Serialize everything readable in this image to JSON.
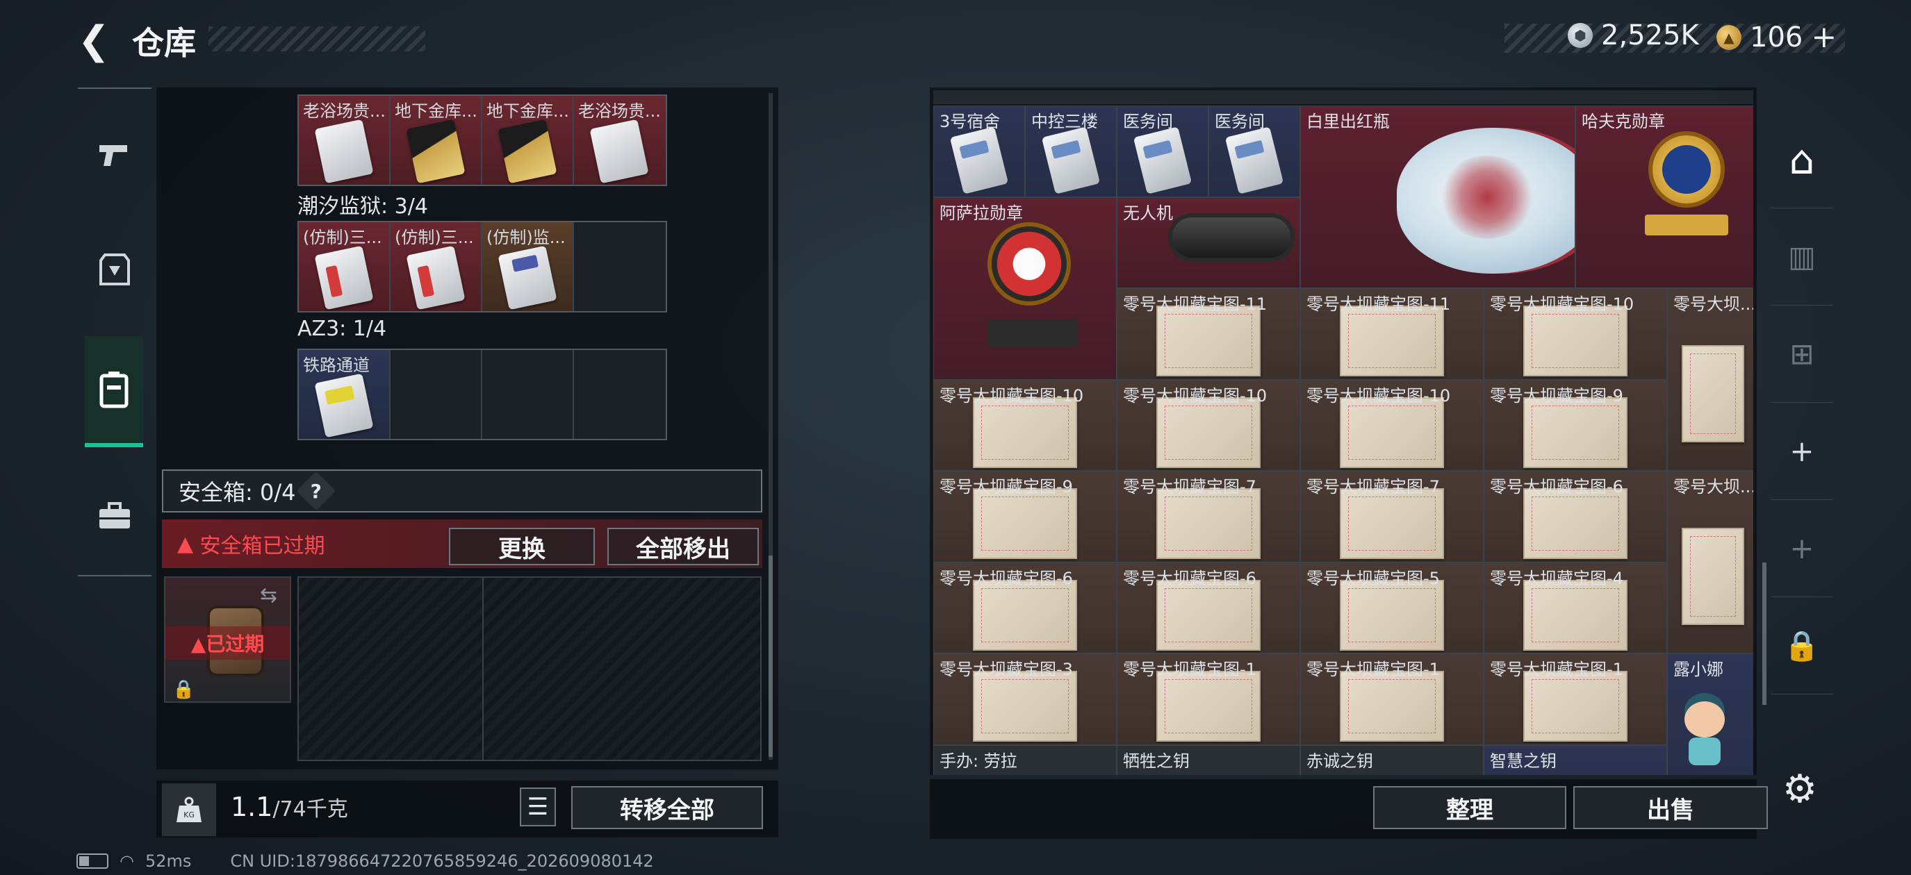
{
  "header": {
    "title": "仓库",
    "silver_amount": "2,525K",
    "gold_amount": "106",
    "gold_plus": "+"
  },
  "sidenav": {
    "items": [
      {
        "icon": "gun-icon",
        "glyph": "▰"
      },
      {
        "icon": "armor-icon",
        "glyph": "⬙"
      },
      {
        "icon": "backpack-icon",
        "glyph": "▣",
        "active": true
      },
      {
        "icon": "toolbox-icon",
        "glyph": "▬"
      }
    ]
  },
  "left": {
    "group1_items": [
      {
        "name": "老浴场贵...",
        "color": "red",
        "card": "white"
      },
      {
        "name": "地下金库...",
        "color": "red",
        "card": "gold"
      },
      {
        "name": "地下金库...",
        "color": "red",
        "card": "gold"
      },
      {
        "name": "老浴场贵...",
        "color": "red",
        "card": "white"
      }
    ],
    "group2_label": "潮汐监狱: 3/4",
    "group2_items": [
      {
        "name": "(仿制)三...",
        "color": "red",
        "card": "red"
      },
      {
        "name": "(仿制)三...",
        "color": "red",
        "card": "red"
      },
      {
        "name": "(仿制)监...",
        "color": "gold",
        "card": "blue"
      },
      {
        "name": "",
        "color": "empty"
      }
    ],
    "group3_label": "AZ3: 1/4",
    "group3_items": [
      {
        "name": "铁路通道",
        "color": "blue",
        "card": "yellow"
      },
      {
        "name": "",
        "color": "empty"
      },
      {
        "name": "",
        "color": "empty"
      },
      {
        "name": "",
        "color": "empty"
      }
    ],
    "safebox_label": "安全箱: 0/4",
    "safebox_help": "?",
    "expired_warning": "安全箱已过期",
    "replace_button": "更换",
    "remove_all_button": "全部移出",
    "case_status": "已过期",
    "weight_value": "1.1",
    "weight_capacity": "/74千克",
    "kg_label": "KG",
    "transfer_all_button": "转移全部"
  },
  "right": {
    "cells": [
      {
        "name": "3号宿舍",
        "color": "blue",
        "kind": "card",
        "col": 0,
        "row": 0
      },
      {
        "name": "中控三楼",
        "color": "blue",
        "kind": "card",
        "col": 1,
        "row": 0
      },
      {
        "name": "医务间",
        "color": "blue",
        "kind": "card",
        "col": 2,
        "row": 0
      },
      {
        "name": "医务间",
        "color": "blue",
        "kind": "card",
        "col": 3,
        "row": 0
      },
      {
        "name": "白里出红瓶",
        "color": "red",
        "kind": "vase",
        "col": 4,
        "row": 0,
        "w": 3,
        "h": 2
      },
      {
        "name": "哈夫克勋章",
        "color": "red",
        "kind": "medal",
        "col": 7,
        "row": 0,
        "w": 2,
        "h": 2
      },
      {
        "name": "阿萨拉勋章",
        "color": "red",
        "kind": "redmedal",
        "col": 0,
        "row": 1,
        "w": 2,
        "h": 2
      },
      {
        "name": "无人机",
        "color": "red",
        "kind": "drone",
        "col": 2,
        "row": 1,
        "w": 2,
        "h": 1
      },
      {
        "name": "零号大坝藏宝图-11",
        "color": "brown",
        "kind": "map",
        "col": 2,
        "row": 2,
        "w": 2
      },
      {
        "name": "零号大坝藏宝图-11",
        "color": "brown",
        "kind": "map",
        "col": 4,
        "row": 2,
        "w": 2
      },
      {
        "name": "零号大坝藏宝图-10",
        "color": "brown",
        "kind": "map",
        "col": 6,
        "row": 2,
        "w": 2
      },
      {
        "name": "零号大坝...",
        "color": "brown",
        "kind": "maptall",
        "col": 8,
        "row": 2,
        "w": 1,
        "h": 2
      },
      {
        "name": "零号大坝藏宝图-10",
        "color": "brown",
        "kind": "map",
        "col": 0,
        "row": 3,
        "w": 2
      },
      {
        "name": "零号大坝藏宝图-10",
        "color": "brown",
        "kind": "map",
        "col": 2,
        "row": 3,
        "w": 2
      },
      {
        "name": "零号大坝藏宝图-10",
        "color": "brown",
        "kind": "map",
        "col": 4,
        "row": 3,
        "w": 2
      },
      {
        "name": "零号大坝藏宝图-9",
        "color": "brown",
        "kind": "map",
        "col": 6,
        "row": 3,
        "w": 2
      },
      {
        "name": "零号大坝藏宝图-9",
        "color": "brown",
        "kind": "map",
        "col": 0,
        "row": 4,
        "w": 2
      },
      {
        "name": "零号大坝藏宝图-7",
        "color": "brown",
        "kind": "map",
        "col": 2,
        "row": 4,
        "w": 2
      },
      {
        "name": "零号大坝藏宝图-7",
        "color": "brown",
        "kind": "map",
        "col": 4,
        "row": 4,
        "w": 2
      },
      {
        "name": "零号大坝藏宝图-6",
        "color": "brown",
        "kind": "map",
        "col": 6,
        "row": 4,
        "w": 2
      },
      {
        "name": "零号大坝...",
        "color": "brown",
        "kind": "maptall",
        "col": 8,
        "row": 4,
        "w": 1,
        "h": 2
      },
      {
        "name": "零号大坝藏宝图-6",
        "color": "brown",
        "kind": "map",
        "col": 0,
        "row": 5,
        "w": 2
      },
      {
        "name": "零号大坝藏宝图-6",
        "color": "brown",
        "kind": "map",
        "col": 2,
        "row": 5,
        "w": 2
      },
      {
        "name": "零号大坝藏宝图-5",
        "color": "brown",
        "kind": "map",
        "col": 4,
        "row": 5,
        "w": 2
      },
      {
        "name": "零号大坝藏宝图-4",
        "color": "brown",
        "kind": "map",
        "col": 6,
        "row": 5,
        "w": 2
      },
      {
        "name": "零号大坝藏宝图-3",
        "color": "brown",
        "kind": "map",
        "col": 0,
        "row": 6,
        "w": 2
      },
      {
        "name": "零号大坝藏宝图-1",
        "color": "brown",
        "kind": "map",
        "col": 2,
        "row": 6,
        "w": 2
      },
      {
        "name": "零号大坝藏宝图-1",
        "color": "brown",
        "kind": "map",
        "col": 4,
        "row": 6,
        "w": 2
      },
      {
        "name": "零号大坝藏宝图-1",
        "color": "brown",
        "kind": "map",
        "col": 6,
        "row": 6,
        "w": 2
      },
      {
        "name": "露小娜",
        "color": "blue",
        "kind": "figure",
        "col": 8,
        "row": 6,
        "w": 1,
        "h": 2
      },
      {
        "name": "手办: 劳拉",
        "color": "gray",
        "kind": "none",
        "col": 0,
        "row": 7,
        "w": 2
      },
      {
        "name": "牺牲之钥",
        "color": "gray",
        "kind": "none",
        "col": 2,
        "row": 7,
        "w": 2
      },
      {
        "name": "赤诚之钥",
        "color": "gray",
        "kind": "none",
        "col": 4,
        "row": 7,
        "w": 2
      },
      {
        "name": "智慧之钥",
        "color": "blue",
        "kind": "none",
        "col": 6,
        "row": 7,
        "w": 2
      }
    ],
    "tidy_button": "整理",
    "sell_button": "出售",
    "nav": [
      {
        "icon": "storage-icon",
        "glyph": "⌂",
        "dim": false
      },
      {
        "icon": "container-icon",
        "glyph": "▥",
        "dim": true
      },
      {
        "icon": "add-container-icon",
        "glyph": "⊞",
        "dim": true
      },
      {
        "icon": "plus-icon",
        "glyph": "+",
        "dim": false
      },
      {
        "icon": "plus-icon",
        "glyph": "+",
        "dim": true
      },
      {
        "icon": "lock-icon",
        "glyph": "🔒",
        "dim": false
      }
    ]
  },
  "status": {
    "ping": "52ms",
    "uid": "CN UID:1879866472207658592​46_202609080142"
  }
}
